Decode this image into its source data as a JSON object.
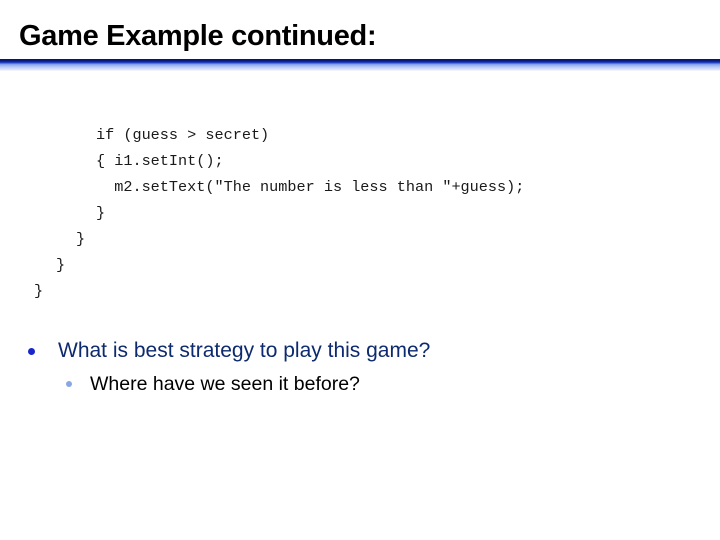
{
  "slide": {
    "title": "Game Example continued:"
  },
  "code": {
    "lines": [
      "if (guess > secret)",
      "{ i1.setInt();",
      "  m2.setText(\"The number is less than \"+guess);",
      "}"
    ],
    "closing_braces": [
      "}",
      "}",
      "}"
    ]
  },
  "bullets": {
    "level1": {
      "text": "What is best strategy to play this game?",
      "bullet_color": "#1a26c8",
      "text_color": "#0e2a6e"
    },
    "level2": {
      "text": "Where have we seen it before?",
      "bullet_color": "#8aa6e6",
      "text_color": "#000000"
    }
  },
  "colors": {
    "rule_dark": "#0a1460",
    "rule_light": "#a8bdf2"
  }
}
